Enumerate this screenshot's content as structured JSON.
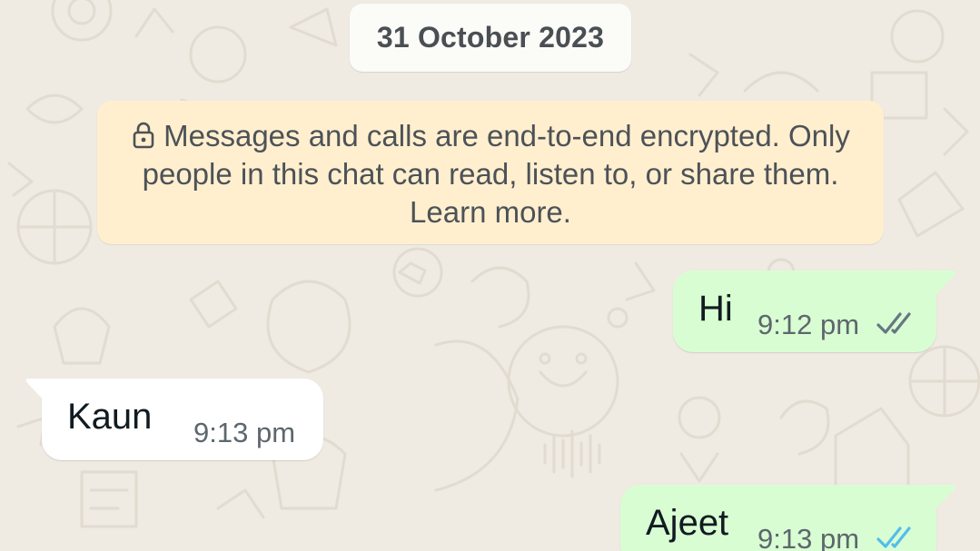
{
  "chat": {
    "date_label": "31 October 2023",
    "encryption_notice": {
      "icon": "lock-icon",
      "text": "Messages and calls are end-to-end encrypted. Only people in this chat can read, listen to, or share them. Learn more."
    },
    "messages": [
      {
        "direction": "outgoing",
        "text": "Hi",
        "time": "9:12 pm",
        "status": "read",
        "status_icon": "double-check-icon"
      },
      {
        "direction": "incoming",
        "text": "Kaun",
        "time": "9:13 pm"
      },
      {
        "direction": "outgoing",
        "text": "Ajeet",
        "time": "9:13 pm",
        "status": "read",
        "status_icon": "double-check-icon"
      }
    ]
  },
  "colors": {
    "wallpaper": "#efeae2",
    "outgoing_bubble": "#d9fdd3",
    "incoming_bubble": "#ffffff",
    "notice_background": "#ffefcf",
    "tick_delivered": "#667781",
    "tick_read": "#53bdeb"
  }
}
